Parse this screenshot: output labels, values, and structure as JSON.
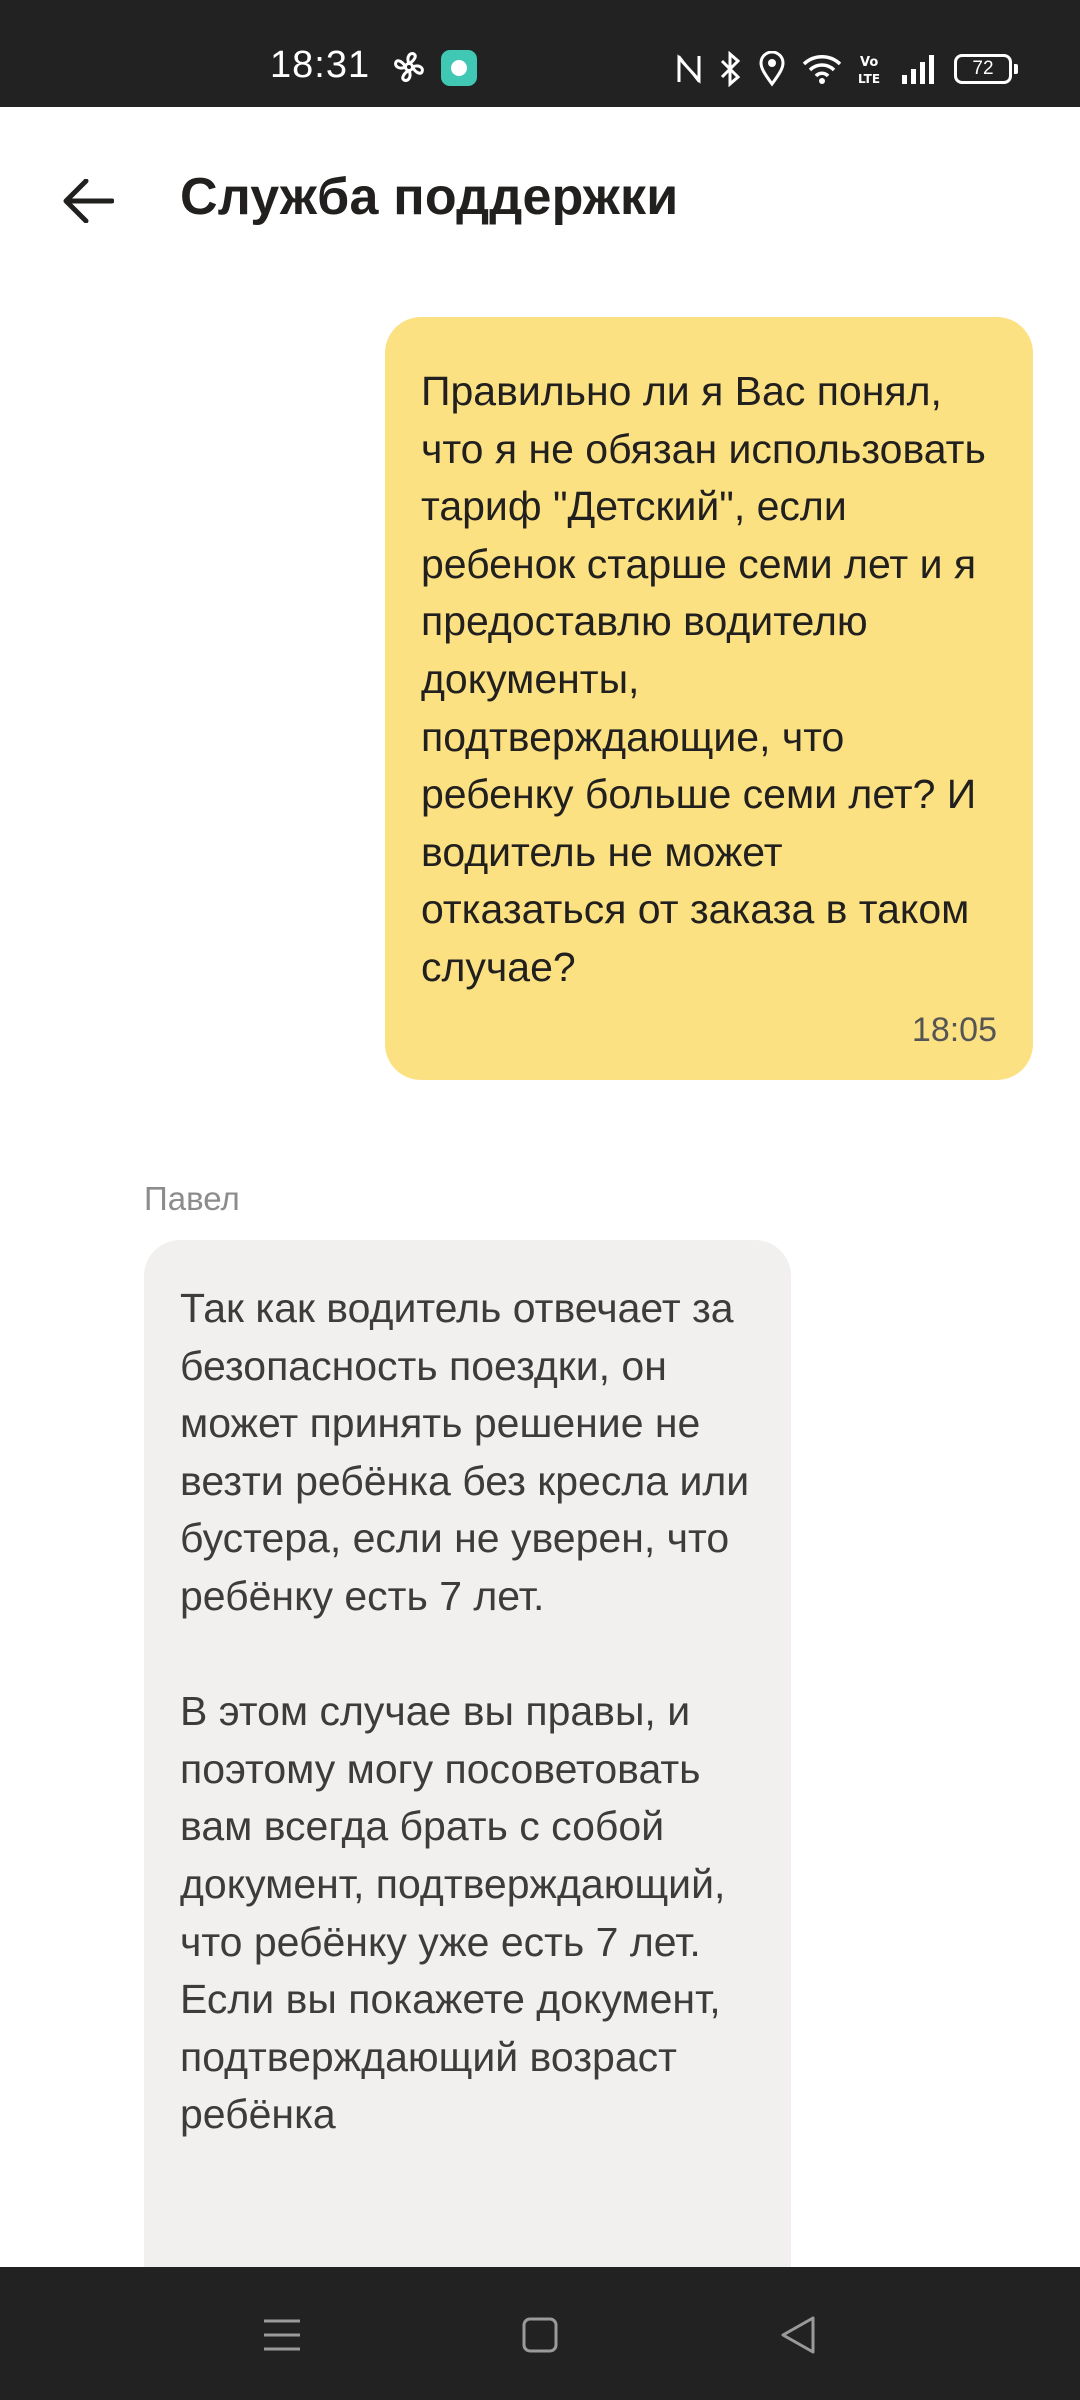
{
  "status_bar": {
    "time": "18:31",
    "battery": "72",
    "icons": [
      "fan-icon",
      "app-notification-icon",
      "nfc-icon",
      "bluetooth-icon",
      "location-icon",
      "wifi-icon",
      "volte-icon",
      "signal-icon",
      "battery-icon"
    ]
  },
  "header": {
    "back_icon": "arrow-left-icon",
    "title": "Служба поддержки"
  },
  "messages": [
    {
      "direction": "outgoing",
      "text": "Правильно ли я Вас понял, что я не обязан использовать тариф \"Детский\", если ребенок старше семи лет и я предоставлю водителю документы, подтверждающие, что ребенку больше семи лет? И водитель не может отказаться от заказа в таком случае?",
      "time": "18:05"
    },
    {
      "direction": "incoming",
      "sender": "Павел",
      "text": "Так как водитель отвечает за безопасность поездки, он может принять решение не везти ребёнка без кресла или бустера, если не уверен, что ребёнку есть 7 лет.\n\nВ этом случае вы правы, и поэтому могу посоветовать вам всегда брать с собой документ, подтверждающий, что ребёнку уже есть 7 лет. Если вы покажете документ, подтверждающий возраст ребёнка"
    }
  ],
  "nav_bar": {
    "icons": [
      "menu-icon",
      "home-icon",
      "back-icon"
    ]
  },
  "colors": {
    "outgoing_bubble": "#fce182",
    "incoming_bubble": "#f1f0ee",
    "system_bars": "#222222"
  }
}
